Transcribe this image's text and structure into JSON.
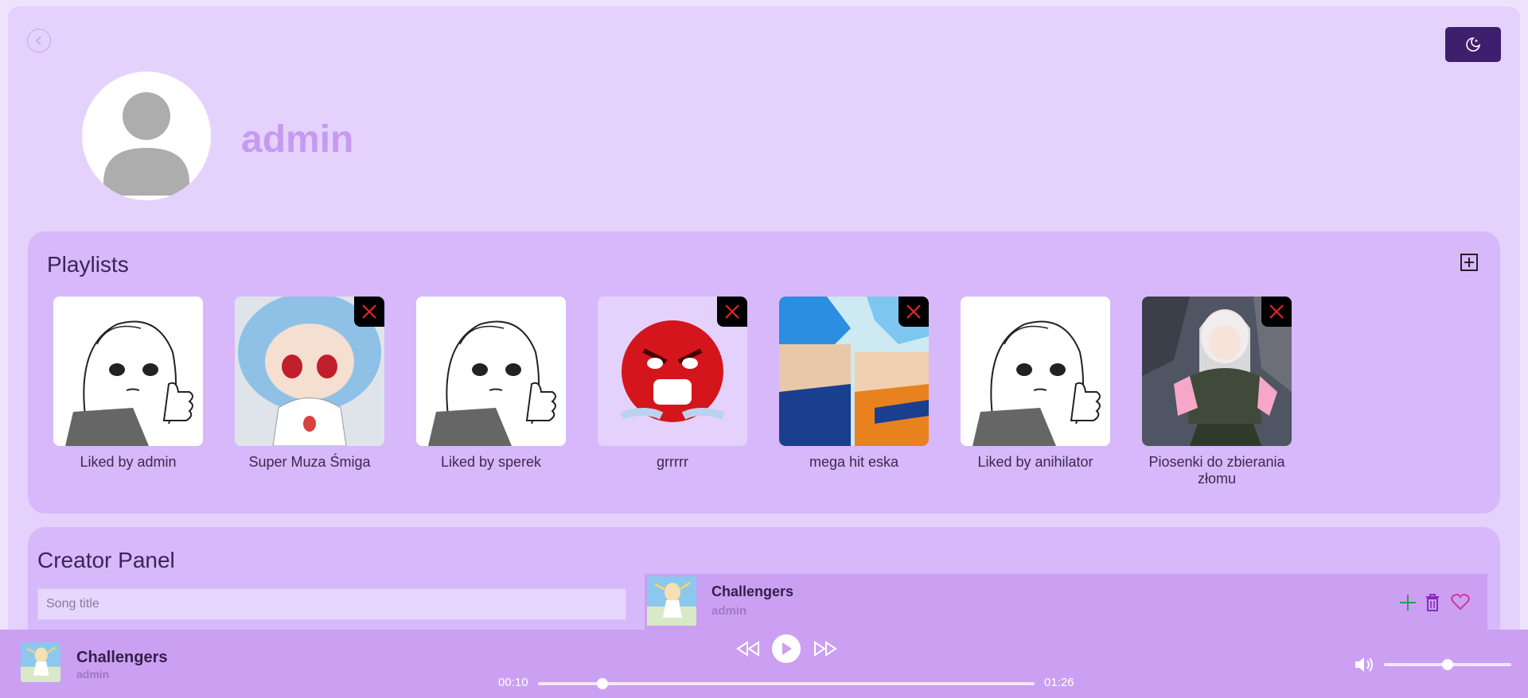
{
  "profile": {
    "username": "admin"
  },
  "playlists": {
    "title": "Playlists",
    "items": [
      {
        "name": "Liked by admin",
        "cover": "manga-thumbs-up",
        "deletable": false
      },
      {
        "name": "Super Muza Śmiga",
        "cover": "blue-hair-plush",
        "deletable": true
      },
      {
        "name": "Liked by sperek",
        "cover": "manga-thumbs-up",
        "deletable": false
      },
      {
        "name": "grrrrr",
        "cover": "red-angry-emoji",
        "deletable": true
      },
      {
        "name": "mega hit eska",
        "cover": "anime-fighters",
        "deletable": true
      },
      {
        "name": "Liked by anihilator",
        "cover": "manga-thumbs-up",
        "deletable": false
      },
      {
        "name": "Piosenki do zbierania złomu",
        "cover": "anime-girl-scrap",
        "deletable": true
      }
    ]
  },
  "creator_panel": {
    "title": "Creator Panel",
    "song_title_placeholder": "Song title",
    "song": {
      "title": "Challengers",
      "artist": "admin"
    }
  },
  "player": {
    "title": "Challengers",
    "artist": "admin",
    "current_time": "00:10",
    "total_time": "01:26",
    "progress_fraction": 0.13,
    "volume_fraction": 0.5
  },
  "colors": {
    "accent_dark": "#3d1f6e",
    "username": "#c79af1",
    "panel": "#d7b8fb",
    "player": "#cb9ff2",
    "add_green": "#2e9b55",
    "delete_purple": "#8a2bc0",
    "heart_pink": "#d0398f"
  }
}
